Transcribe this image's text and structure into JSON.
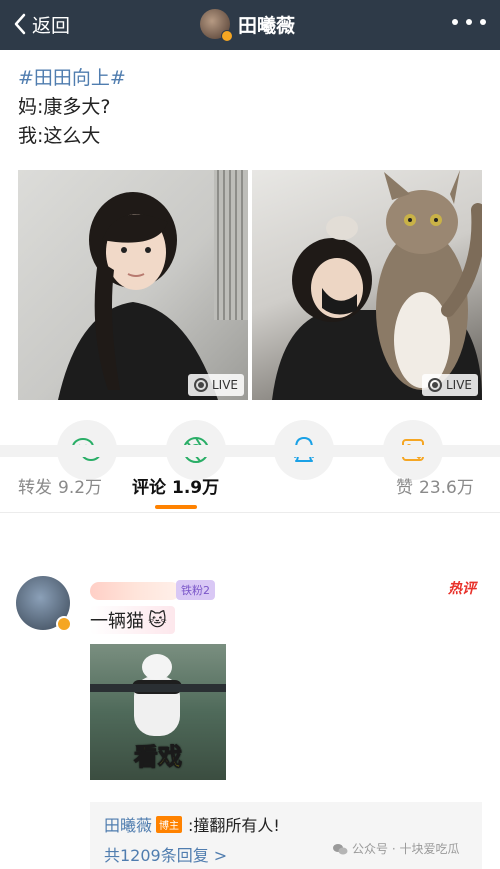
{
  "nav": {
    "back_label": "返回",
    "title": "田曦薇"
  },
  "post": {
    "topic": "#田田向上#",
    "line1": "妈:康多大?",
    "line2": "我:这么大",
    "photos": [
      {
        "badge": "LIVE"
      },
      {
        "badge": "LIVE"
      }
    ]
  },
  "share": {
    "icons": [
      "wechat-icon",
      "moments-icon",
      "qq-icon",
      "save-image-icon"
    ]
  },
  "tabs": {
    "repost_label": "转发",
    "repost_count": "9.2万",
    "comment_label": "评论",
    "comment_count": "1.9万",
    "like_label": "赞",
    "like_count": "23.6万"
  },
  "comment": {
    "fan_badge": "铁粉2",
    "hot_badge": "热评",
    "text": "一辆猫",
    "emoji": "🐱",
    "sticker_caption": "看戏",
    "reply": {
      "author": "田曦薇",
      "author_badge": "博主",
      "text": ":撞翻所有人!",
      "more": "共1209条回复 >"
    }
  },
  "watermark": {
    "text": "公众号 · 十块爱吃瓜"
  },
  "colors": {
    "nav_bg": "#2e3a48",
    "link": "#507daf",
    "accent": "#ff8200",
    "hot": "#e8322b"
  }
}
